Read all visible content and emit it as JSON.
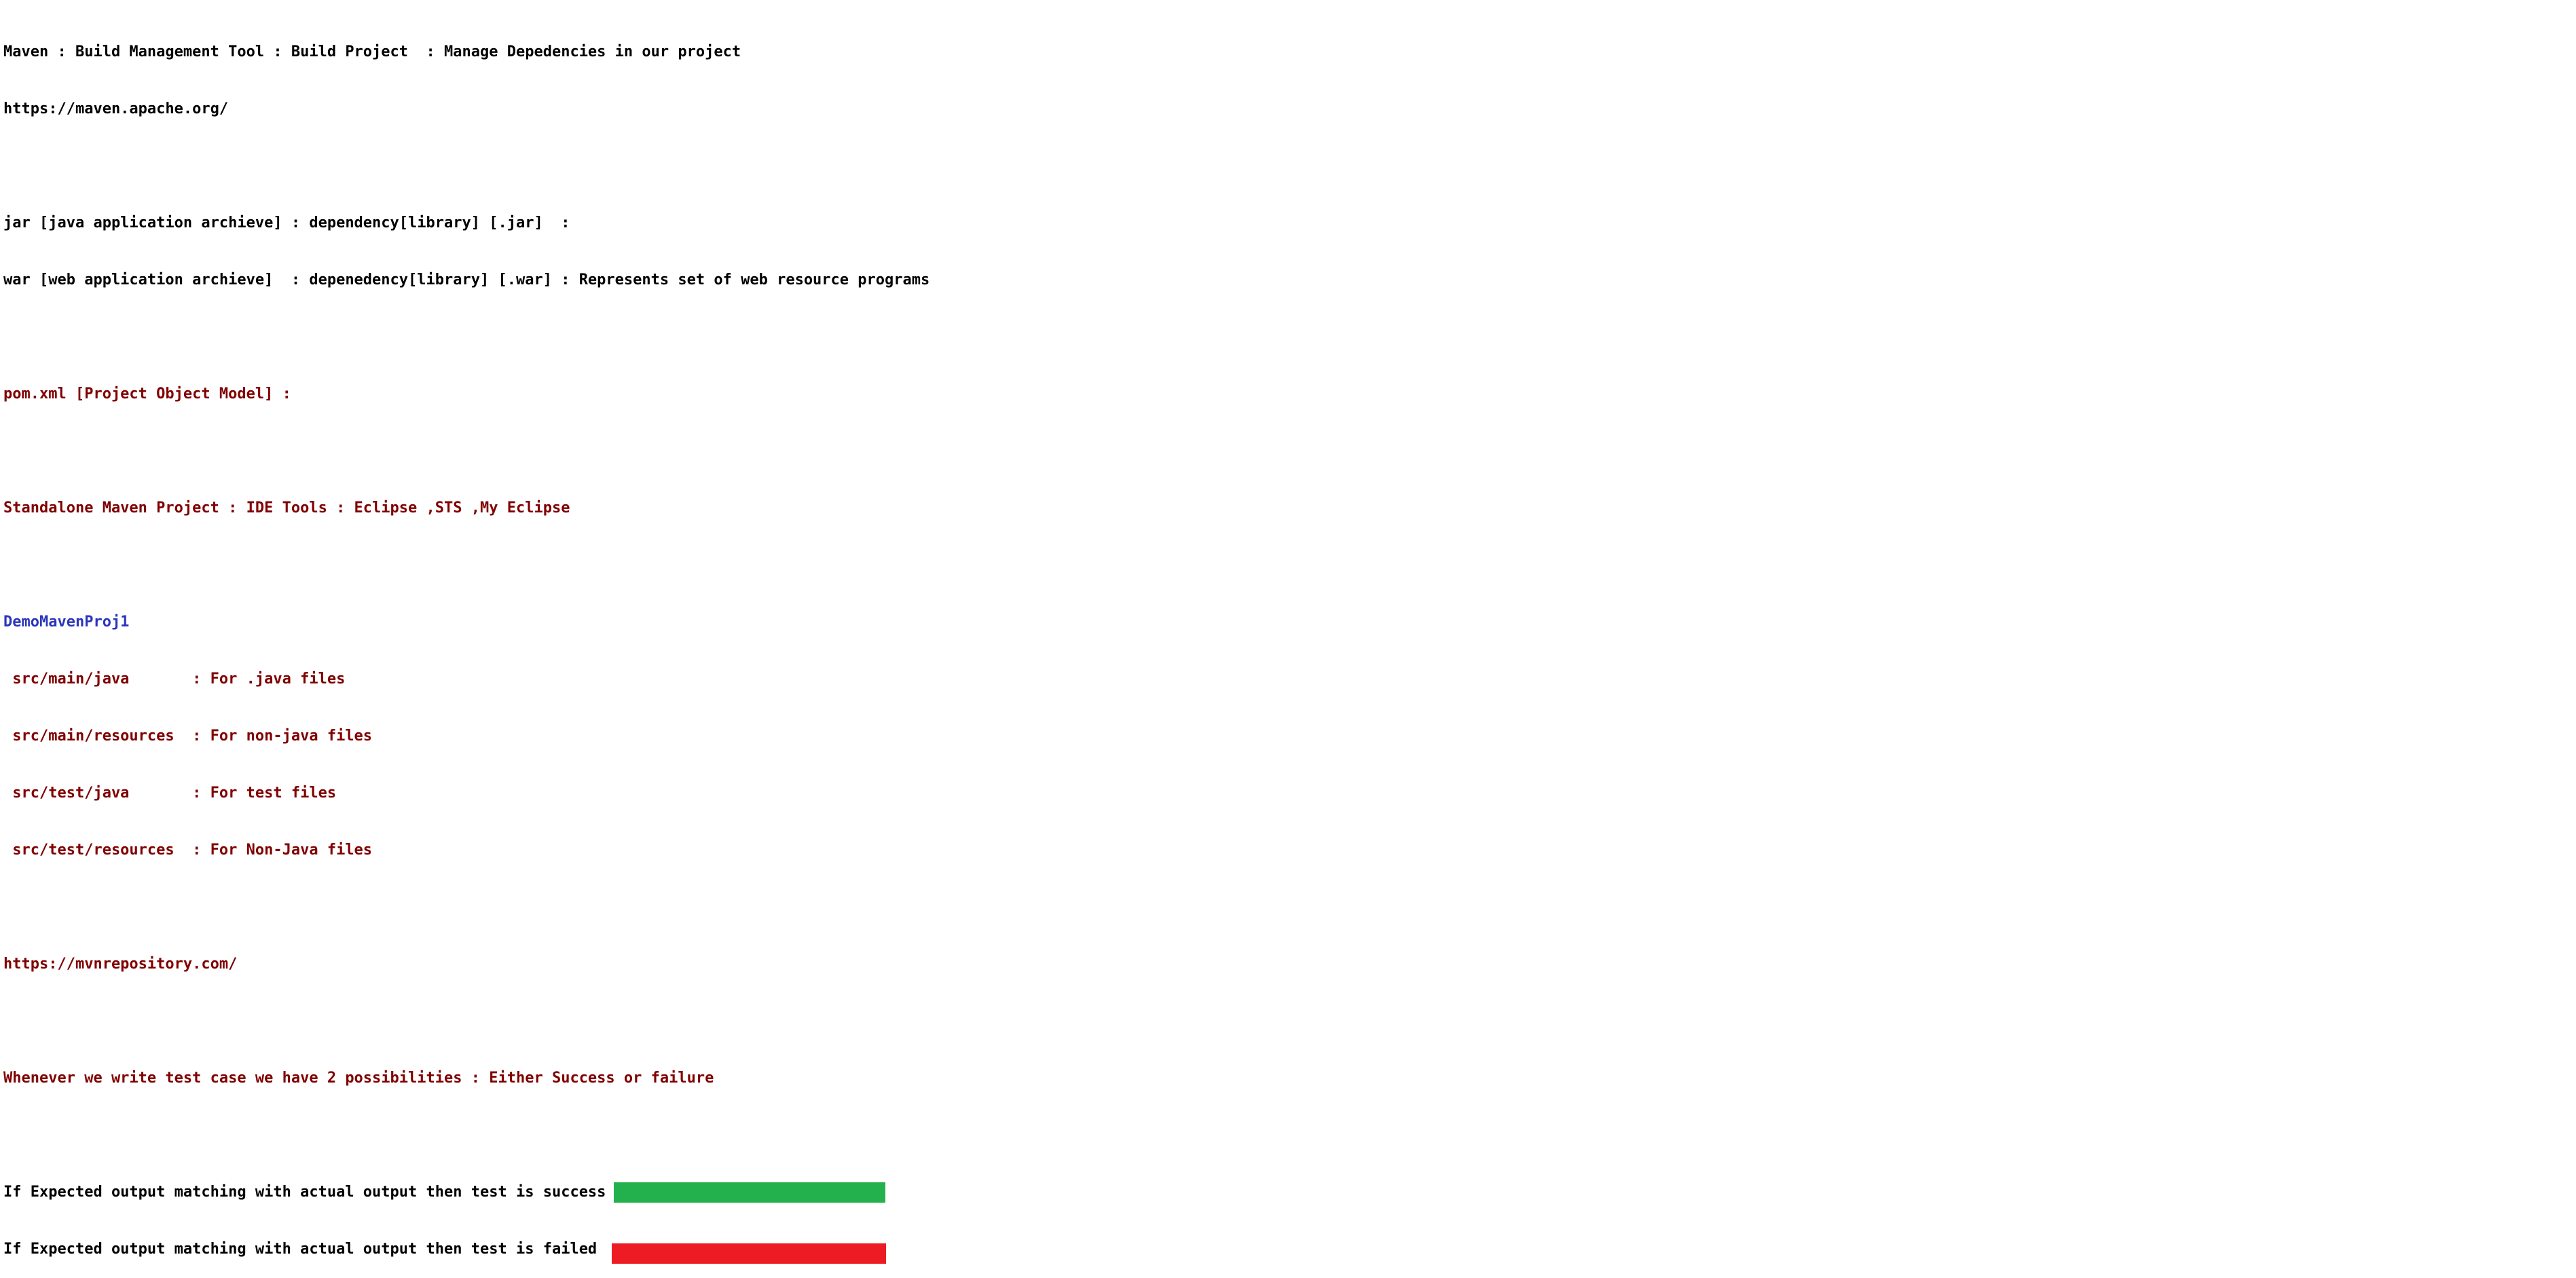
{
  "colors": {
    "text_black": "#000000",
    "text_red": "#800000",
    "text_blue": "#2b35bd",
    "success_bar": "#22b14c",
    "failed_bar": "#ed1c24"
  },
  "lines": {
    "l1": "Maven : Build Management Tool : Build Project  : Manage Depedencies in our project",
    "l2": "https://maven.apache.org/",
    "l3": "jar [java application archieve] : dependency[library] [.jar]  :",
    "l4": "war [web application archieve]  : depenedency[library] [.war] : Represents set of web resource programs",
    "l5": "pom.xml [Project Object Model] :",
    "l6": "Standalone Maven Project : IDE Tools : Eclipse ,STS ,My Eclipse",
    "l7": "DemoMavenProj1",
    "l8": " src/main/java       : For .java files",
    "l9": " src/main/resources  : For non-java files",
    "l10": " src/test/java       : For test files",
    "l11": " src/test/resources  : For Non-Java files",
    "l12": "https://mvnrepository.com/",
    "l13": "Whenever we write test case we have 2 possibilities : Either Success or failure",
    "l14": "If Expected output matching with actual output then test is success",
    "l15": "If Expected output matching with actual output then test is failed"
  },
  "bars": {
    "success_fill": 1.0,
    "failed_fill": 1.0
  }
}
